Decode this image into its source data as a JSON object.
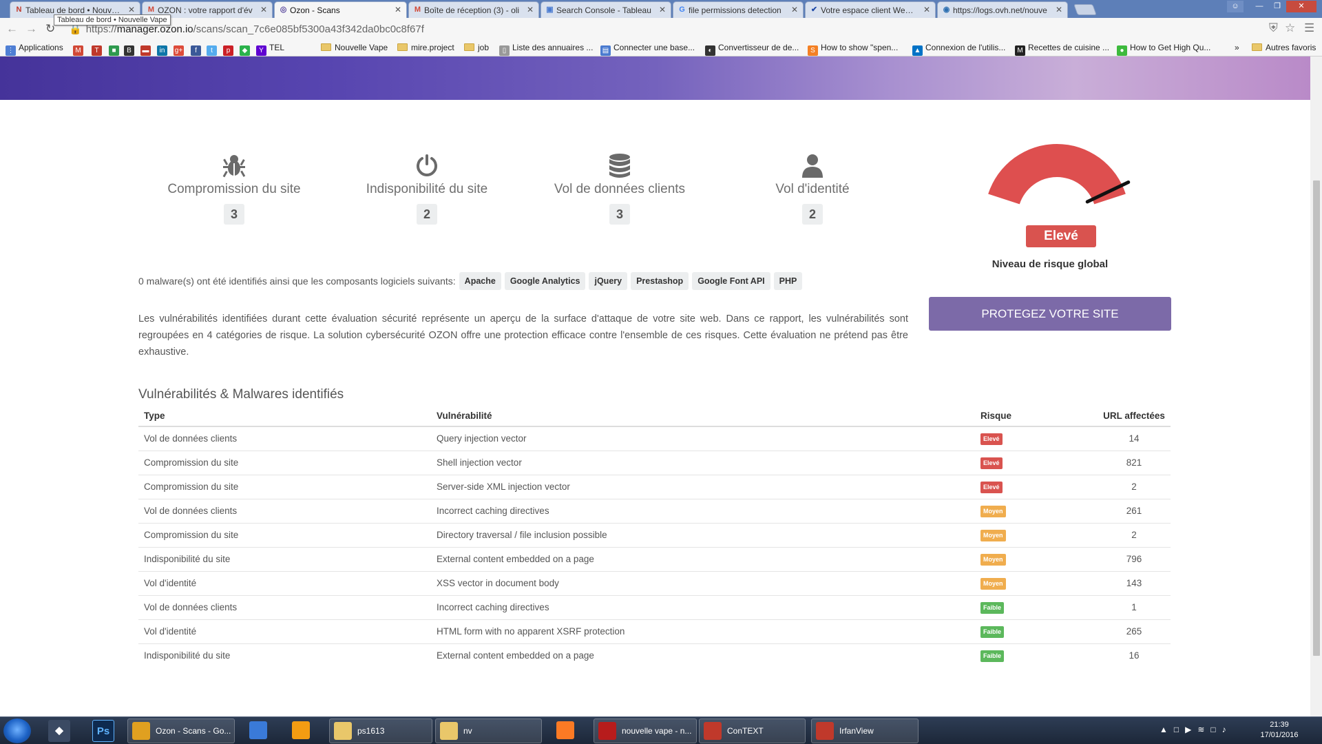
{
  "browser": {
    "tabs": [
      {
        "title": "Tableau de bord • Nouvelle",
        "favicon": "n-red-icon",
        "active": false
      },
      {
        "title": "OZON : votre rapport d'év",
        "favicon": "gmail-icon",
        "active": false
      },
      {
        "title": "Ozon - Scans",
        "favicon": "ozon-icon",
        "active": true
      },
      {
        "title": "Boîte de réception (3) - oli",
        "favicon": "gmail-icon",
        "active": false
      },
      {
        "title": "Search Console - Tableau",
        "favicon": "search-console-icon",
        "active": false
      },
      {
        "title": "file permissions detection",
        "favicon": "google-icon",
        "active": false
      },
      {
        "title": "Votre espace client Web C",
        "favicon": "ovh-icon",
        "active": false
      },
      {
        "title": "https://logs.ovh.net/nouve",
        "favicon": "globe-icon",
        "active": false
      }
    ],
    "tooltip": "Tableau de bord • Nouvelle Vape",
    "url_scheme": "https://",
    "url_host": "manager.ozon.io",
    "url_path": "/scans/scan_7c6e085bf5300a43f342da0bc0c8f67f",
    "bookmarks": [
      {
        "label": "Applications",
        "icon": "apps-grid-icon"
      },
      {
        "label": "",
        "icon": "gmail-icon"
      },
      {
        "label": "",
        "icon": "t-red-icon"
      },
      {
        "label": "",
        "icon": "green-square-icon"
      },
      {
        "label": "",
        "icon": "b-icon"
      },
      {
        "label": "",
        "icon": "flag-icon"
      },
      {
        "label": "",
        "icon": "linkedin-icon"
      },
      {
        "label": "",
        "icon": "google-plus-icon"
      },
      {
        "label": "",
        "icon": "facebook-icon"
      },
      {
        "label": "",
        "icon": "twitter-icon"
      },
      {
        "label": "",
        "icon": "pinterest-icon"
      },
      {
        "label": "",
        "icon": "feedly-icon"
      },
      {
        "label": "TEL",
        "icon": "yahoo-icon"
      },
      {
        "label": "Nouvelle Vape",
        "icon": "folder-icon"
      },
      {
        "label": "mire.project",
        "icon": "folder-icon"
      },
      {
        "label": "job",
        "icon": "folder-icon"
      },
      {
        "label": "Liste des annuaires ...",
        "icon": "page-icon"
      },
      {
        "label": "Connecter une base...",
        "icon": "db-icon"
      },
      {
        "label": "Convertisseur de de...",
        "icon": "convert-icon"
      },
      {
        "label": "How to show \"spen...",
        "icon": "stack-icon"
      },
      {
        "label": "Connexion de l'utilis...",
        "icon": "azure-icon"
      },
      {
        "label": "Recettes de cuisine ...",
        "icon": "marmiton-icon"
      },
      {
        "label": "How to Get High Qu...",
        "icon": "green-circle-icon"
      }
    ],
    "bookmarks_more": "»",
    "other_bookmarks": "Autres favoris"
  },
  "categories": [
    {
      "label": "Compromission du site",
      "count": "3",
      "icon": "bug-icon"
    },
    {
      "label": "Indisponibilité du site",
      "count": "2",
      "icon": "power-icon"
    },
    {
      "label": "Vol de données clients",
      "count": "3",
      "icon": "database-icon"
    },
    {
      "label": "Vol d'identité",
      "count": "2",
      "icon": "user-icon"
    }
  ],
  "risk": {
    "level": "Elevé",
    "caption": "Niveau de risque global",
    "gauge_fraction": 0.9,
    "gauge_color": "#de4f4f"
  },
  "protect_button": "PROTEGEZ VOTRE SITE",
  "malware_text": "0 malware(s) ont été identifiés ainsi que les composants logiciels suivants:",
  "components": [
    "Apache",
    "Google Analytics",
    "jQuery",
    "Prestashop",
    "Google Font API",
    "PHP"
  ],
  "intro": "Les vulnérabilités identifiées durant cette évaluation sécurité représente un aperçu de la surface d'attaque de votre site web. Dans ce rapport, les vulnérabilités sont regroupées en 4 catégories de risque. La solution cybersécurité OZON offre une protection efficace contre l'ensemble de ces risques. Cette évaluation ne prétend pas être exhaustive.",
  "vuln_section_title": "Vulnérabilités & Malwares identifiés",
  "table": {
    "headers": {
      "type": "Type",
      "vuln": "Vulnérabilité",
      "risk": "Risque",
      "urls": "URL affectées"
    },
    "risk_colors": {
      "Elevé": "#d9534f",
      "Moyen": "#f0ad4e",
      "Faible": "#5cb85c"
    },
    "rows": [
      {
        "type": "Vol de données clients",
        "vuln": "Query injection vector",
        "risk": "Elevé",
        "urls": "14"
      },
      {
        "type": "Compromission du site",
        "vuln": "Shell injection vector",
        "risk": "Elevé",
        "urls": "821"
      },
      {
        "type": "Compromission du site",
        "vuln": "Server-side XML injection vector",
        "risk": "Elevé",
        "urls": "2"
      },
      {
        "type": "Vol de données clients",
        "vuln": "Incorrect caching directives",
        "risk": "Moyen",
        "urls": "261"
      },
      {
        "type": "Compromission du site",
        "vuln": "Directory traversal / file inclusion possible",
        "risk": "Moyen",
        "urls": "2"
      },
      {
        "type": "Indisponibilité du site",
        "vuln": "External content embedded on a page",
        "risk": "Moyen",
        "urls": "796"
      },
      {
        "type": "Vol d'identité",
        "vuln": "XSS vector in document body",
        "risk": "Moyen",
        "urls": "143"
      },
      {
        "type": "Vol de données clients",
        "vuln": "Incorrect caching directives",
        "risk": "Faible",
        "urls": "1"
      },
      {
        "type": "Vol d'identité",
        "vuln": "HTML form with no apparent XSRF protection",
        "risk": "Faible",
        "urls": "265"
      },
      {
        "type": "Indisponibilité du site",
        "vuln": "External content embedded on a page",
        "risk": "Faible",
        "urls": "16"
      }
    ]
  },
  "taskbar": {
    "pinned": [
      {
        "icon": "windows-start-icon"
      },
      {
        "icon": "app-switch-icon"
      },
      {
        "icon": "photoshop-icon",
        "label": "Ps"
      }
    ],
    "buttons": [
      {
        "label": "Ozon - Scans - Go...",
        "icon": "chrome-icon"
      },
      {
        "label": "",
        "icon": "thunderbird-icon"
      },
      {
        "label": "",
        "icon": "sun-icon"
      },
      {
        "label": "ps1613",
        "icon": "folder-icon"
      },
      {
        "label": "nv",
        "icon": "folder-icon"
      },
      {
        "label": "",
        "icon": "xampp-icon"
      },
      {
        "label": "nouvelle vape - n...",
        "icon": "filezilla-icon"
      },
      {
        "label": "ConTEXT",
        "icon": "context-icon"
      },
      {
        "label": "IrfanView",
        "icon": "irfanview-icon"
      }
    ],
    "time": "21:39",
    "date": "17/01/2016"
  }
}
